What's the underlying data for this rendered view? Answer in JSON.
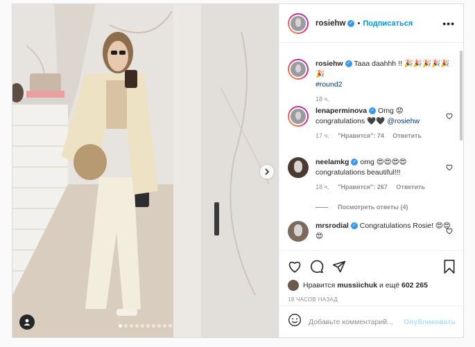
{
  "post": {
    "author": "rosiehw",
    "header_separator": "•",
    "follow_label": "Подписаться",
    "more_label": "•••",
    "verified_mark": "✓"
  },
  "comments": [
    {
      "username": "rosiehw",
      "text": "Taaa daahhh !! ",
      "emoji": "🎉🎉🎉🎉🎉🎉",
      "hashtag": "#round2",
      "time": "18 ч.",
      "liked_icon": false
    },
    {
      "username": "lenaperminova",
      "text": "Omg 😟 congratulations 🖤🖤 ",
      "mention": "@rosiehw",
      "time": "17 ч.",
      "likes": "\"Нравится\": 74",
      "reply_label": "Ответить",
      "liked_icon": true
    },
    {
      "username": "neelamkg",
      "text": "omg 😍😍😍😍 congratulations beautiful!!!",
      "time": "18 ч.",
      "likes": "\"Нравится\": 267",
      "reply_label": "Ответить",
      "liked_icon": true
    },
    {
      "username": "mrsrodial",
      "text": "Congratulations Rosie! 😍😍😍",
      "liked_icon": true
    }
  ],
  "view_replies_label": "Посмотреть ответы (4)",
  "likes_line": {
    "prefix": "Нравится ",
    "user": "mussiichuk",
    "suffix": " и ещё ",
    "count": "602 265"
  },
  "timestamp": "18 ЧАСОВ НАЗАД",
  "add_comment": {
    "placeholder": "Добавьте комментарий...",
    "publish_label": "Опубликовать"
  },
  "icons": {
    "next": "chevron-right-icon",
    "tag": "user-tag-icon",
    "like": "heart-icon",
    "comment": "comment-icon",
    "share": "paper-plane-icon",
    "save": "bookmark-icon",
    "emoji": "smiley-icon"
  },
  "carousel": {
    "slides": 10,
    "active": 0
  },
  "colors": {
    "accent": "#0095f6",
    "muted": "#8e8e8e",
    "text": "#262626"
  }
}
